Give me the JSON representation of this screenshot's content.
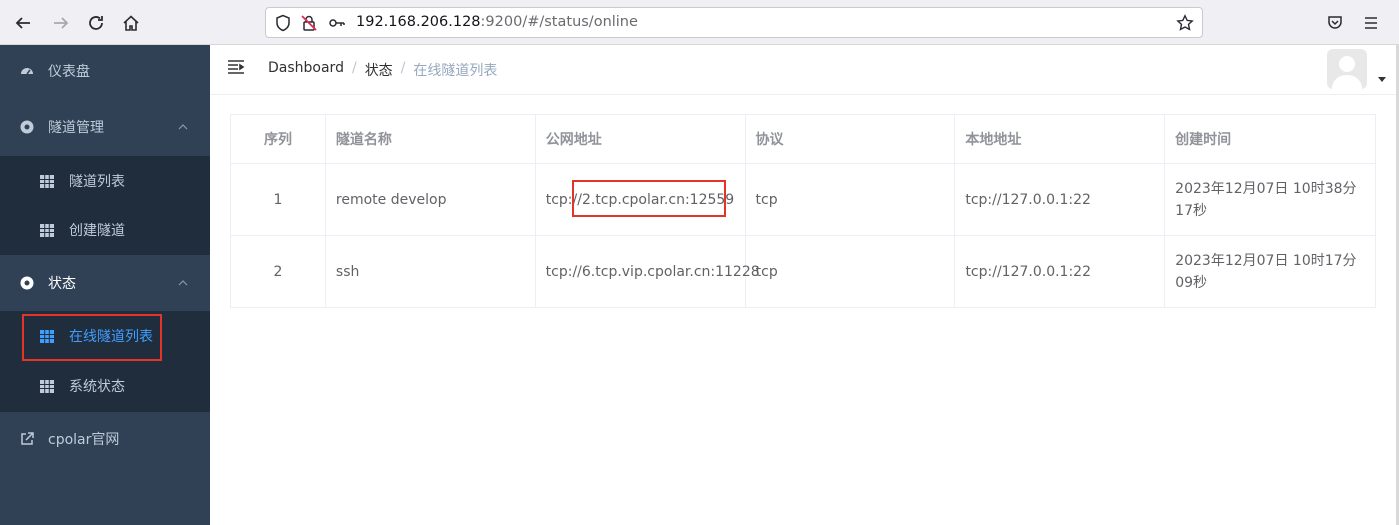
{
  "browser": {
    "url_host": "192.168.206.128",
    "url_rest": ":9200/#/status/online"
  },
  "sidebar": {
    "dashboard": "仪表盘",
    "tunnel_mgmt": "隧道管理",
    "tunnel_list": "隧道列表",
    "create_tunnel": "创建隧道",
    "status": "状态",
    "online_tunnels": "在线隧道列表",
    "system_status": "系统状态",
    "cpolar_site": "cpolar官网"
  },
  "breadcrumb": {
    "items": [
      "Dashboard",
      "状态",
      "在线隧道列表"
    ]
  },
  "table": {
    "headers": [
      "序列",
      "隧道名称",
      "公网地址",
      "协议",
      "本地地址",
      "创建时间"
    ],
    "rows": [
      [
        "1",
        "remote develop",
        "tcp://2.tcp.cpolar.cn:12559",
        "tcp",
        "tcp://127.0.0.1:22",
        "2023年12月07日 10时38分17秒"
      ],
      [
        "2",
        "ssh",
        "tcp://6.tcp.vip.cpolar.cn:11228",
        "tcp",
        "tcp://127.0.0.1:22",
        "2023年12月07日 10时17分09秒"
      ]
    ]
  },
  "colors": {
    "sidebar_bg": "#304156",
    "submenu_bg": "#1f2d3d",
    "active": "#409eff",
    "highlight_box": "#e5332a"
  }
}
